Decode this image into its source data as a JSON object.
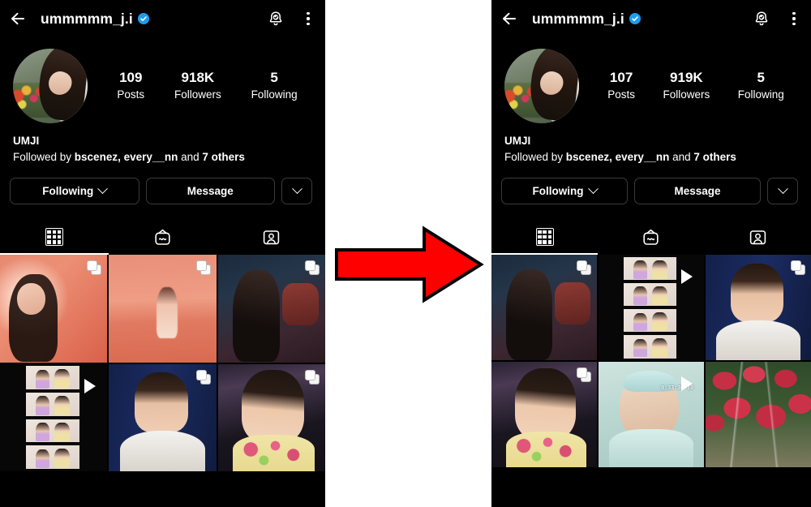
{
  "meta": {
    "description": "Before/after Instagram profile screenshot comparison with red arrow",
    "background_color": "#ffffff",
    "panel_background": "#000000",
    "accent_verified_blue": "#1d9bf0",
    "arrow_color": "#ff0000",
    "arrow_outline": "#000000"
  },
  "arrow": {
    "name": "right-arrow",
    "direction": "right"
  },
  "before": {
    "header": {
      "back_label": "Back",
      "username": "ummmmm_j.i",
      "verified": true,
      "bell_label": "Notifications",
      "menu_label": "More options"
    },
    "avatar_alt": "Profile photo: woman with long dark hair in white top beside tulips",
    "stats": [
      {
        "value": "109",
        "label": "Posts"
      },
      {
        "value": "918K",
        "label": "Followers"
      },
      {
        "value": "5",
        "label": "Following"
      }
    ],
    "bio": {
      "display_name": "UMJI",
      "followed_by_prefix": "Followed by ",
      "followed_by_names": "bscenez, every__nn",
      "followed_by_mid": " and ",
      "followed_by_others": "7 others"
    },
    "buttons": {
      "following": "Following",
      "message": "Message",
      "more": "More"
    },
    "tabs": [
      {
        "name": "grid",
        "label": "Posts grid",
        "active": true
      },
      {
        "name": "igtv",
        "label": "IGTV",
        "active": false
      },
      {
        "name": "tagged",
        "label": "Tagged",
        "active": false
      }
    ],
    "posts": [
      {
        "art": "art-pink-portrait",
        "alt": "Portrait in pink light wearing white shirt",
        "type": "carousel"
      },
      {
        "art": "art-pink-beach",
        "alt": "Woman sitting in pink hazy water",
        "type": "carousel"
      },
      {
        "art": "art-bus-selfie",
        "alt": "Selfie in tour bus with black lace top",
        "type": "carousel"
      },
      {
        "art": "art-photobooth",
        "alt": "Photobooth strip of two women",
        "type": "video"
      },
      {
        "art": "art-blue-curtain",
        "alt": "Portrait in white blouse against blue curtain",
        "type": "carousel"
      },
      {
        "art": "art-floral",
        "alt": "Selfie in yellow floral dress",
        "type": "carousel"
      }
    ]
  },
  "after": {
    "header": {
      "back_label": "Back",
      "username": "ummmmm_j.i",
      "verified": true,
      "bell_label": "Notifications",
      "menu_label": "More options"
    },
    "avatar_alt": "Profile photo: woman with long dark hair in white top beside tulips",
    "stats": [
      {
        "value": "107",
        "label": "Posts"
      },
      {
        "value": "919K",
        "label": "Followers"
      },
      {
        "value": "5",
        "label": "Following"
      }
    ],
    "bio": {
      "display_name": "UMJI",
      "followed_by_prefix": "Followed by ",
      "followed_by_names": "bscenez, every__nn",
      "followed_by_mid": " and ",
      "followed_by_others": "7 others"
    },
    "buttons": {
      "following": "Following",
      "message": "Message",
      "more": "More"
    },
    "tabs": [
      {
        "name": "grid",
        "label": "Posts grid",
        "active": true
      },
      {
        "name": "igtv",
        "label": "IGTV",
        "active": false
      },
      {
        "name": "tagged",
        "label": "Tagged",
        "active": false
      }
    ],
    "posts": [
      {
        "art": "art-bus-selfie",
        "alt": "Selfie in tour bus with black lace top",
        "type": "carousel"
      },
      {
        "art": "art-photobooth",
        "alt": "Photobooth strip of two women",
        "type": "video"
      },
      {
        "art": "art-blue-curtain",
        "alt": "Portrait in white blouse against blue curtain",
        "type": "carousel"
      },
      {
        "art": "art-floral",
        "alt": "Selfie in yellow floral dress",
        "type": "carousel"
      },
      {
        "art": "art-kid-video",
        "alt": "Retro camcorder clip of a child in light blue",
        "type": "video",
        "timestamp": "0:33:30 10"
      },
      {
        "art": "art-tulips",
        "alt": "Red and white tulips in a field",
        "type": "photo"
      }
    ]
  }
}
